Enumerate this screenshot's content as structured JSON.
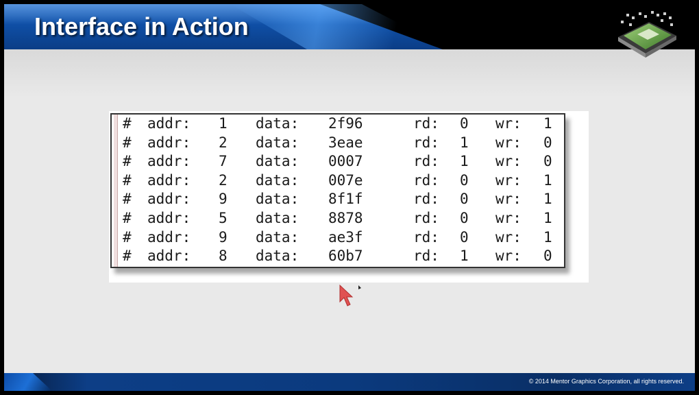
{
  "header": {
    "title": "Interface in Action",
    "logo_icon": "chip-logo-icon"
  },
  "terminal": {
    "labels": {
      "hash": "#",
      "addr": "addr:",
      "data": "data:",
      "rd": "rd:",
      "wr": "wr:"
    },
    "rows": [
      {
        "addr": "1",
        "data": "2f96",
        "rd": "0",
        "wr": "1"
      },
      {
        "addr": "2",
        "data": "3eae",
        "rd": "1",
        "wr": "0"
      },
      {
        "addr": "7",
        "data": "0007",
        "rd": "1",
        "wr": "0"
      },
      {
        "addr": "2",
        "data": "007e",
        "rd": "0",
        "wr": "1"
      },
      {
        "addr": "9",
        "data": "8f1f",
        "rd": "0",
        "wr": "1"
      },
      {
        "addr": "5",
        "data": "8878",
        "rd": "0",
        "wr": "1"
      },
      {
        "addr": "9",
        "data": "ae3f",
        "rd": "0",
        "wr": "1"
      },
      {
        "addr": "8",
        "data": "60b7",
        "rd": "1",
        "wr": "0"
      }
    ]
  },
  "footer": {
    "copyright": "© 2014 Mentor Graphics Corporation, all rights reserved."
  },
  "colors": {
    "header_blue": "#1f6fd1",
    "footer_blue": "#0b3a7e",
    "cursor_red": "#e05252"
  }
}
